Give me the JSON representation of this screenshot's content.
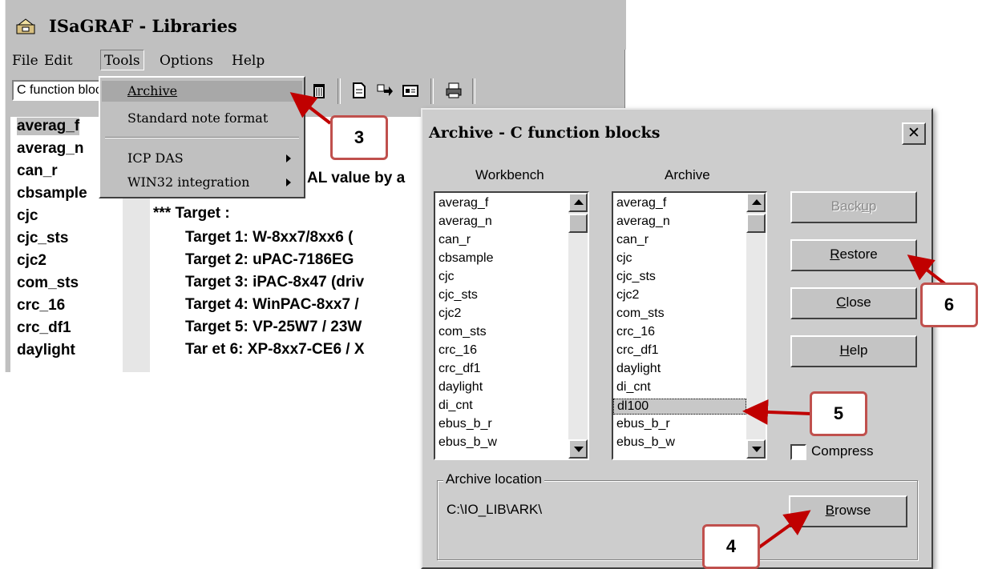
{
  "main_window": {
    "title": "ISaGRAF - Libraries",
    "menu": [
      "File",
      "Edit",
      "Tools",
      "Options",
      "Help"
    ],
    "toolbar": {
      "combo_value": "C function blocks"
    },
    "libraries": [
      "averag_f",
      "averag_n",
      "can_r",
      "cbsample",
      "cjc",
      "cjc_sts",
      "cjc2",
      "com_sts",
      "crc_16",
      "crc_df1",
      "daylight"
    ],
    "note_lines": [
      "AL value by a",
      "*** Target :",
      "Target 1:  W-8xx7/8xx6  (",
      "Target 2:  uPAC-7186EG",
      "Target 3:  iPAC-8x47  (driv",
      "Target 4:  WinPAC-8xx7 /",
      "Target 5:  VP-25W7 / 23W",
      "Tar  et 6:  XP-8xx7-CE6 / X"
    ]
  },
  "tools_menu": {
    "items": [
      "Archive",
      "Standard note format",
      "ICP DAS",
      "WIN32 integration"
    ]
  },
  "dialog": {
    "title": "Archive - C function blocks",
    "close_glyph": "✕",
    "workbench_label": "Workbench",
    "archive_label": "Archive",
    "workbench_items": [
      "averag_f",
      "averag_n",
      "can_r",
      "cbsample",
      "cjc",
      "cjc_sts",
      "cjc2",
      "com_sts",
      "crc_16",
      "crc_df1",
      "daylight",
      "di_cnt",
      "ebus_b_r",
      "ebus_b_w"
    ],
    "archive_items": [
      "averag_f",
      "averag_n",
      "can_r",
      "cjc",
      "cjc_sts",
      "cjc2",
      "com_sts",
      "crc_16",
      "crc_df1",
      "daylight",
      "di_cnt",
      "dl100",
      "ebus_b_r",
      "ebus_b_w"
    ],
    "archive_selected": "dl100",
    "buttons": {
      "backup": "Backup",
      "restore": "Restore",
      "close": "Close",
      "help": "Help",
      "browse": "Browse"
    },
    "compress_label": "Compress",
    "compress_checked": false,
    "location_label": "Archive location",
    "location_path": "C:\\IO_LIB\\ARK\\"
  },
  "callouts": {
    "c3": "3",
    "c4": "4",
    "c5": "5",
    "c6": "6"
  },
  "colors": {
    "callout_border": "#c0504d",
    "arrow": "#c00000",
    "window_gray": "#c0c0c0"
  }
}
